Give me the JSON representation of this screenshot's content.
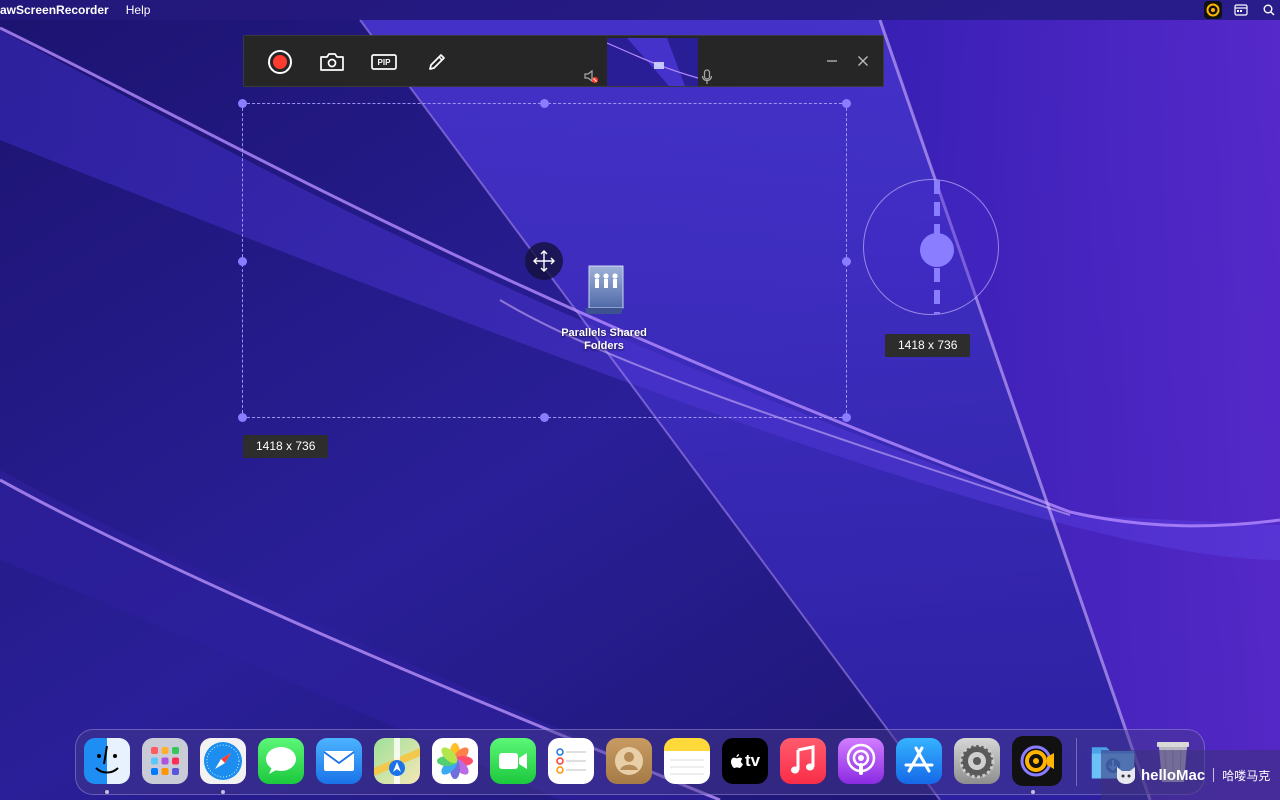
{
  "menubar": {
    "app_name": "awScreenRecorder",
    "menus": [
      "Help"
    ]
  },
  "toolbar": {
    "buttons": [
      {
        "name": "record-icon"
      },
      {
        "name": "camera-icon"
      },
      {
        "name": "pip-icon",
        "label": "PIP"
      },
      {
        "name": "pencil-icon"
      }
    ],
    "speaker_muted": true
  },
  "selection": {
    "dimensions": "1418 x 736"
  },
  "magnifier": {
    "dimensions": "1418 x 736"
  },
  "desktop_icon": {
    "label_line1": "Parallels Shared",
    "label_line2": "Folders"
  },
  "dock": {
    "apps": [
      {
        "name": "finder-icon",
        "running": true
      },
      {
        "name": "launchpad-icon",
        "running": false
      },
      {
        "name": "safari-icon",
        "running": true
      },
      {
        "name": "messages-icon",
        "running": false
      },
      {
        "name": "mail-icon",
        "running": false
      },
      {
        "name": "maps-icon",
        "running": false
      },
      {
        "name": "photos-icon",
        "running": false
      },
      {
        "name": "facetime-icon",
        "running": false
      },
      {
        "name": "reminders-icon",
        "running": false
      },
      {
        "name": "contacts-icon",
        "running": false
      },
      {
        "name": "notes-icon",
        "running": false
      },
      {
        "name": "appletv-icon",
        "running": false,
        "label": "tv"
      },
      {
        "name": "music-icon",
        "running": false
      },
      {
        "name": "podcasts-icon",
        "running": false
      },
      {
        "name": "appstore-icon",
        "running": false
      },
      {
        "name": "system-settings-icon",
        "running": false
      },
      {
        "name": "screen-recorder-icon",
        "running": true
      }
    ],
    "right_items": [
      {
        "name": "downloads-folder-icon"
      },
      {
        "name": "trash-icon"
      }
    ]
  },
  "watermark": {
    "brand": "helloMac",
    "cn": "哈喽马克"
  },
  "colors": {
    "wallpaper_base": "#241a8a",
    "accent_purple": "#8a7dff",
    "record_red": "#ff3b30",
    "toolbar_bg": "#262626"
  }
}
